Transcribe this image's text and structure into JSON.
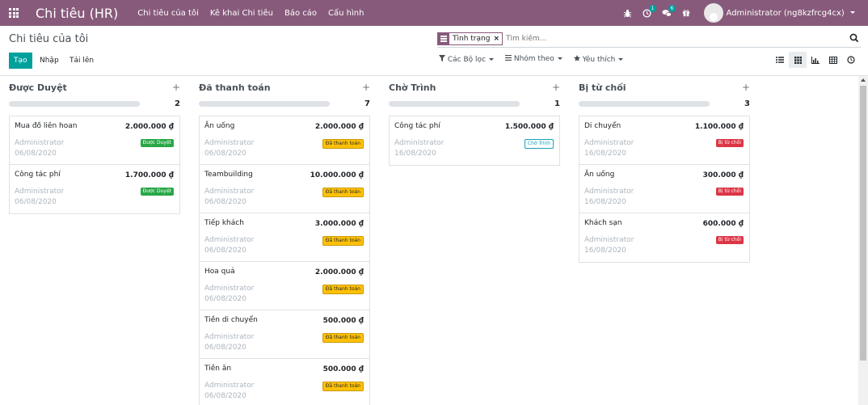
{
  "navbar": {
    "brand": "Chi tiêu (HR)",
    "menu": [
      "Chi tiêu của tôi",
      "Kê khai Chi tiêu",
      "Báo cáo",
      "Cấu hình"
    ],
    "activity_badge": "1",
    "messages_badge": "6",
    "user_name": "Administrator (ng8kzfrcg4cx)",
    "color": "#875a7b"
  },
  "control": {
    "breadcrumb": "Chi tiêu của tôi",
    "facet_label": "Tình trạng",
    "search_placeholder": "Tìm kiếm...",
    "create_label": "Tạo",
    "import_label": "Nhập",
    "upload_label": "Tải lên",
    "filters_label": "Các Bộ lọc",
    "groupby_label": "Nhóm theo",
    "favorites_label": "Yêu thích",
    "accent": "#00a09d"
  },
  "columns": [
    {
      "title": "Được Duyệt",
      "count": "2",
      "cards": [
        {
          "name": "Mua đồ liên hoan",
          "amount": "2.000.000 ₫",
          "user": "Administrator",
          "date": "06/08/2020",
          "tag": "Được Duyệt",
          "tag_style": "green"
        },
        {
          "name": "Công tác phí",
          "amount": "1.700.000 ₫",
          "user": "Administrator",
          "date": "06/08/2020",
          "tag": "Được Duyệt",
          "tag_style": "green"
        }
      ]
    },
    {
      "title": "Đã thanh toán",
      "count": "7",
      "cards": [
        {
          "name": "Ăn uống",
          "amount": "2.000.000 ₫",
          "user": "Administrator",
          "date": "06/08/2020",
          "tag": "Đã thanh toán",
          "tag_style": "yellow"
        },
        {
          "name": "Teambuilding",
          "amount": "10.000.000 ₫",
          "user": "Administrator",
          "date": "06/08/2020",
          "tag": "Đã thanh toán",
          "tag_style": "yellow"
        },
        {
          "name": "Tiếp khách",
          "amount": "3.000.000 ₫",
          "user": "Administrator",
          "date": "06/08/2020",
          "tag": "Đã thanh toán",
          "tag_style": "yellow"
        },
        {
          "name": "Hoa quả",
          "amount": "2.000.000 ₫",
          "user": "Administrator",
          "date": "06/08/2020",
          "tag": "Đã thanh toán",
          "tag_style": "yellow"
        },
        {
          "name": "Tiền di chuyển",
          "amount": "500.000 ₫",
          "user": "Administrator",
          "date": "06/08/2020",
          "tag": "Đã thanh toán",
          "tag_style": "yellow"
        },
        {
          "name": "Tiền ăn",
          "amount": "500.000 ₫",
          "user": "Administrator",
          "date": "06/08/2020",
          "tag": "Đã thanh toán",
          "tag_style": "yellow"
        }
      ]
    },
    {
      "title": "Chờ Trình",
      "count": "1",
      "cards": [
        {
          "name": "Công tác phí",
          "amount": "1.500.000 ₫",
          "user": "Administrator",
          "date": "16/08/2020",
          "tag": "Chờ Trình",
          "tag_style": "outline"
        }
      ]
    },
    {
      "title": "Bị từ chối",
      "count": "3",
      "cards": [
        {
          "name": "Di chuyển",
          "amount": "1.100.000 ₫",
          "user": "Administrator",
          "date": "16/08/2020",
          "tag": "Bị từ chối",
          "tag_style": "red"
        },
        {
          "name": "Ăn uống",
          "amount": "300.000 ₫",
          "user": "Administrator",
          "date": "16/08/2020",
          "tag": "Bị từ chối",
          "tag_style": "red"
        },
        {
          "name": "Khách sạn",
          "amount": "600.000 ₫",
          "user": "Administrator",
          "date": "16/08/2020",
          "tag": "Bị từ chối",
          "tag_style": "red"
        }
      ]
    }
  ]
}
